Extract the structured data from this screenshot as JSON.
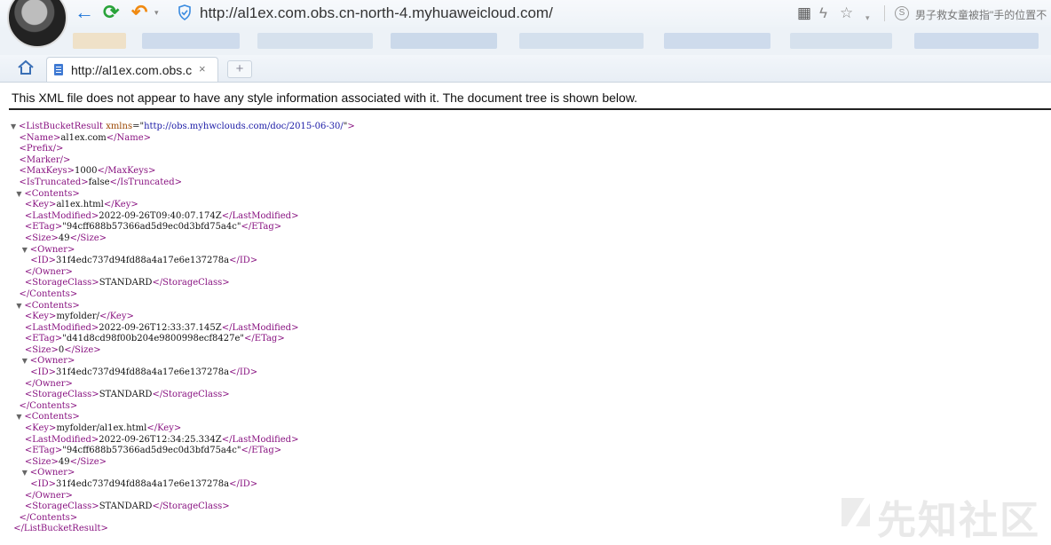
{
  "toolbar": {
    "url": "http://al1ex.com.obs.cn-north-4.myhuaweicloud.com/",
    "back_icon": "←",
    "refresh_icon": "⟳",
    "undo_icon": "↶",
    "dropdown_icon": "▾",
    "qr_icon": "▦",
    "bolt_icon": "ϟ",
    "star_icon": "☆",
    "news_icon": "S",
    "news_text": "男子救女童被指\"手的位置不"
  },
  "tabs": [
    {
      "title": "http://al1ex.com.obs.c",
      "close_icon": "×"
    }
  ],
  "newtab_icon": "+",
  "page": {
    "header": "This XML file does not appear to have any style information associated with it. The document tree is shown below."
  },
  "xml": {
    "root_open": "<ListBucketResult",
    "xmlns_name": "xmlns",
    "xmlns_value": "http://obs.myhwclouds.com/doc/2015-06-30/",
    "root_close": "</ListBucketResult>",
    "name": "al1ex.com",
    "max_keys": "1000",
    "is_truncated": "false",
    "contents": [
      {
        "key": "al1ex.html",
        "last_modified": "2022-09-26T09:40:07.174Z",
        "etag": "\"94cff688b57366ad5d9ec0d3bfd75a4c\"",
        "size": "49",
        "owner_id": "31f4edc737d94fd88a4a17e6e137278a",
        "storage_class": "STANDARD"
      },
      {
        "key": "myfolder/",
        "last_modified": "2022-09-26T12:33:37.145Z",
        "etag": "\"d41d8cd98f00b204e9800998ecf8427e\"",
        "size": "0",
        "owner_id": "31f4edc737d94fd88a4a17e6e137278a",
        "storage_class": "STANDARD"
      },
      {
        "key": "myfolder/al1ex.html",
        "last_modified": "2022-09-26T12:34:25.334Z",
        "etag": "\"94cff688b57366ad5d9ec0d3bfd75a4c\"",
        "size": "49",
        "owner_id": "31f4edc737d94fd88a4a17e6e137278a",
        "storage_class": "STANDARD"
      }
    ]
  },
  "watermark": "先知社区",
  "colors": {
    "tag": "#881280",
    "attr": "#994500",
    "attr_value": "#1a1aa6",
    "accent": "#1c74d8"
  }
}
